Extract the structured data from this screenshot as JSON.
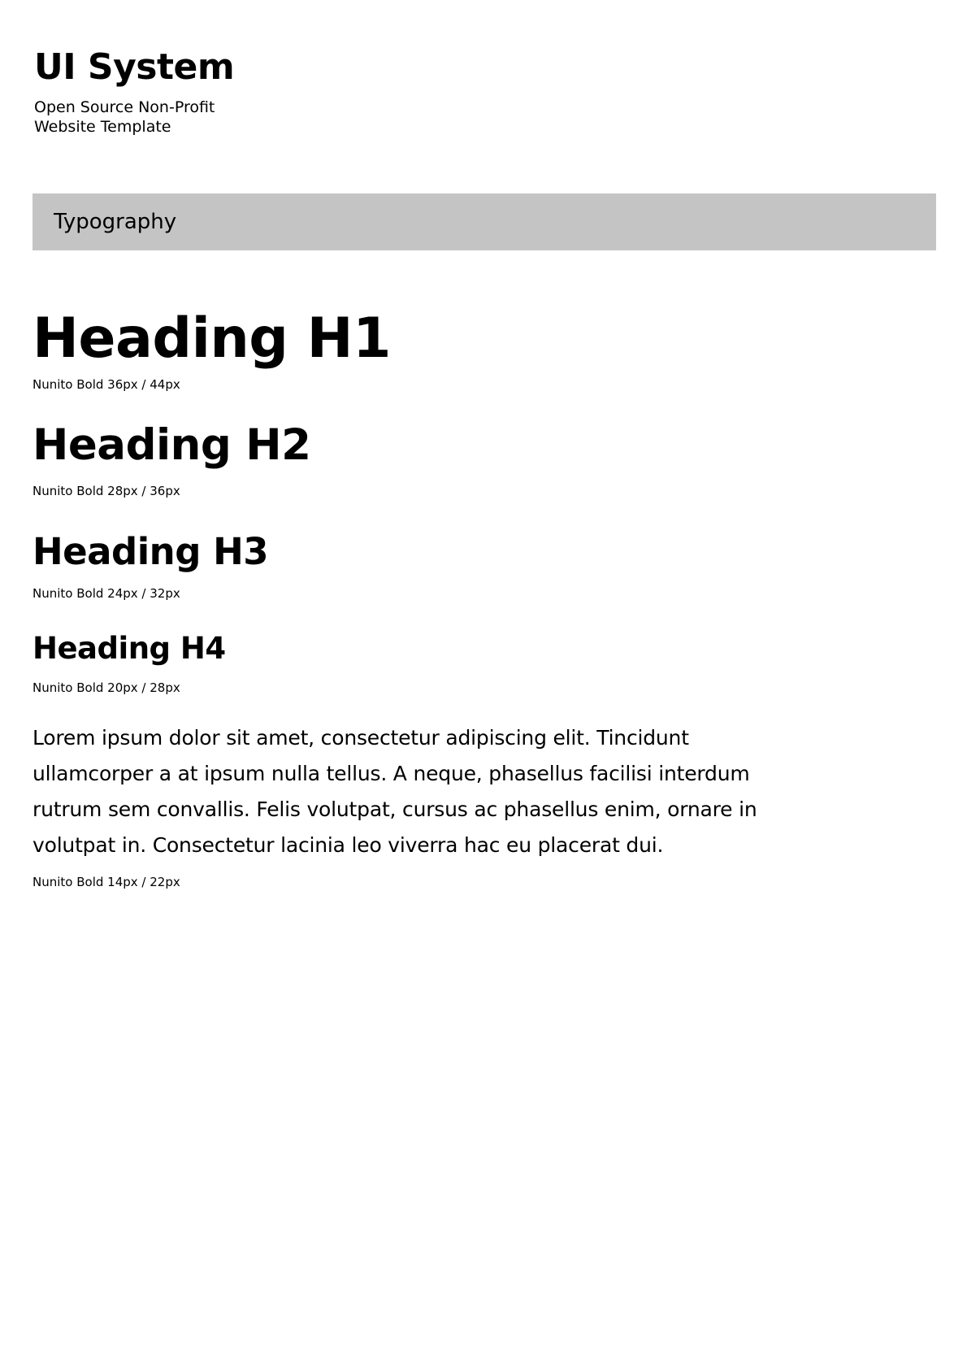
{
  "header": {
    "title": "UI System",
    "subtitle": "Open Source Non-Profit\nWebsite Template"
  },
  "section": {
    "label": "Typography",
    "bar_color": "#c4c4c4"
  },
  "samples": [
    {
      "text": "Heading H1",
      "spec": "Nunito Bold 36px / 44px"
    },
    {
      "text": "Heading H2",
      "spec": "Nunito Bold 28px / 36px"
    },
    {
      "text": "Heading H3",
      "spec": "Nunito Bold 24px / 32px"
    },
    {
      "text": "Heading H4",
      "spec": "Nunito Bold 20px / 28px"
    },
    {
      "text": "Lorem ipsum dolor sit amet, consectetur adipiscing elit. Tincidunt ullamcorper a at ipsum nulla tellus. A neque, phasellus facilisi interdum rutrum sem convallis. Felis volutpat, cursus ac phasellus enim, ornare in volutpat in. Consectetur lacinia leo viverra hac eu placerat dui.",
      "spec": "Nunito Bold 14px / 22px"
    }
  ]
}
